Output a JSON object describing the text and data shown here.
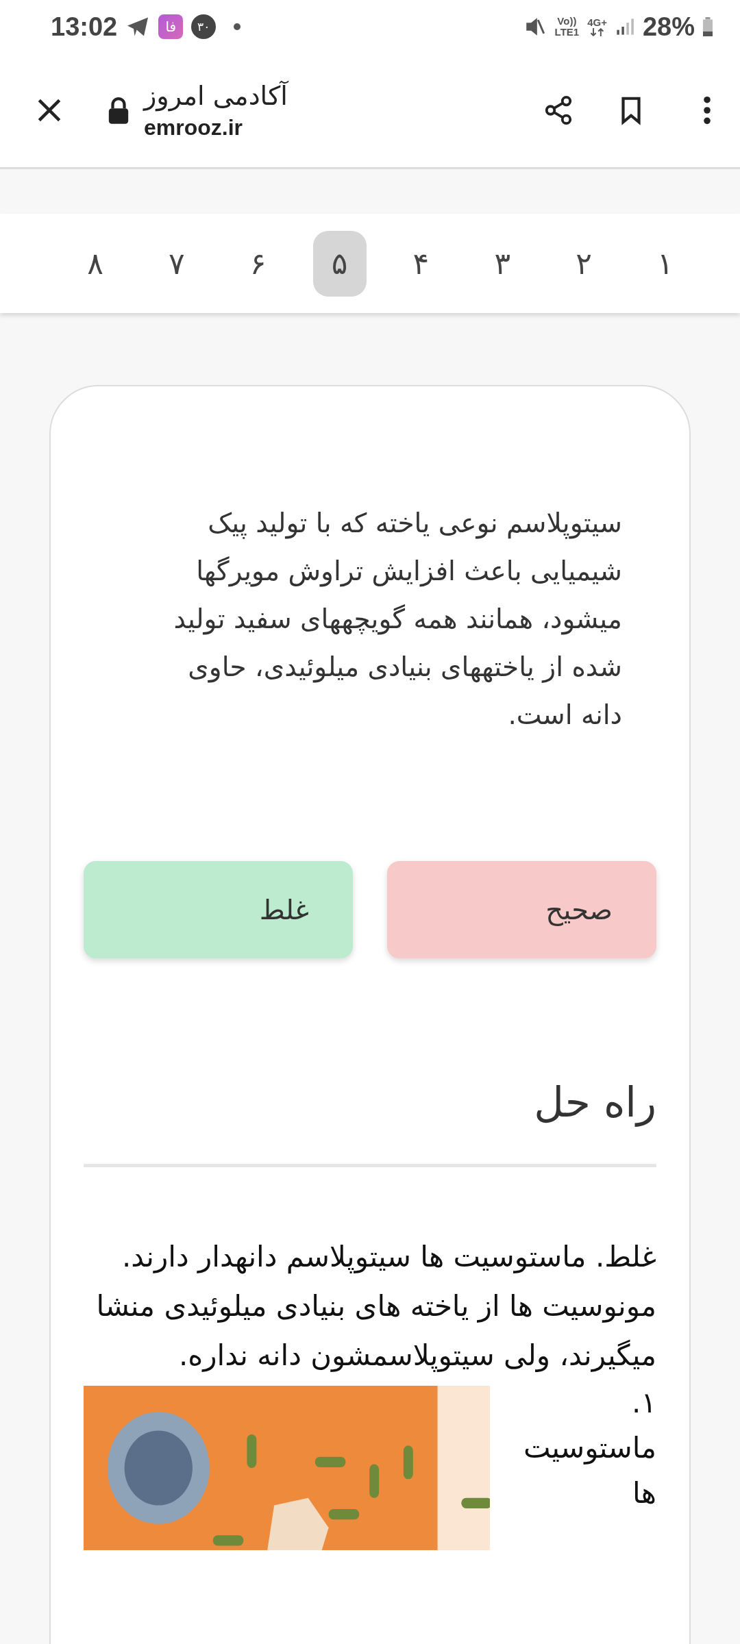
{
  "status_bar": {
    "time": "13:02",
    "notification_badge": "فا",
    "notification_count": "۳۰",
    "volte": "Vo))",
    "lte": "LTE1",
    "network": "4G+",
    "battery": "28%"
  },
  "header": {
    "title": "آکادمی امروز",
    "url": "emrooz.ir"
  },
  "pager": [
    {
      "label": "۱",
      "selected": false
    },
    {
      "label": "۲",
      "selected": false
    },
    {
      "label": "۳",
      "selected": false
    },
    {
      "label": "۴",
      "selected": false
    },
    {
      "label": "۵",
      "selected": true
    },
    {
      "label": "۶",
      "selected": false
    },
    {
      "label": "۷",
      "selected": false
    },
    {
      "label": "۸",
      "selected": false
    }
  ],
  "question": "سیتوپلاسم نوعی یاخته که با تولید پیک شیمیایی باعث افزایش تراوش مویرگها میشود، همانند همه گویچههای سفید تولید شده از یاختههای بنیادی میلوئیدی، حاوی دانه است.",
  "answers": [
    {
      "label": "صحیح",
      "color": "#f8c9c9"
    },
    {
      "label": "غلط",
      "color": "#bdebcf"
    }
  ],
  "solution": {
    "title": "راه حل",
    "text": "غلط. ماستوسیت ها سیتوپلاسم دانهدار دارند. مونوسیت ها از یاخته های بنیادی میلوئیدی منشا میگیرند، ولی سیتوپلاسمشون دانه نداره.",
    "list_number": "۱.",
    "list_text": "ماستوسیت ها"
  }
}
